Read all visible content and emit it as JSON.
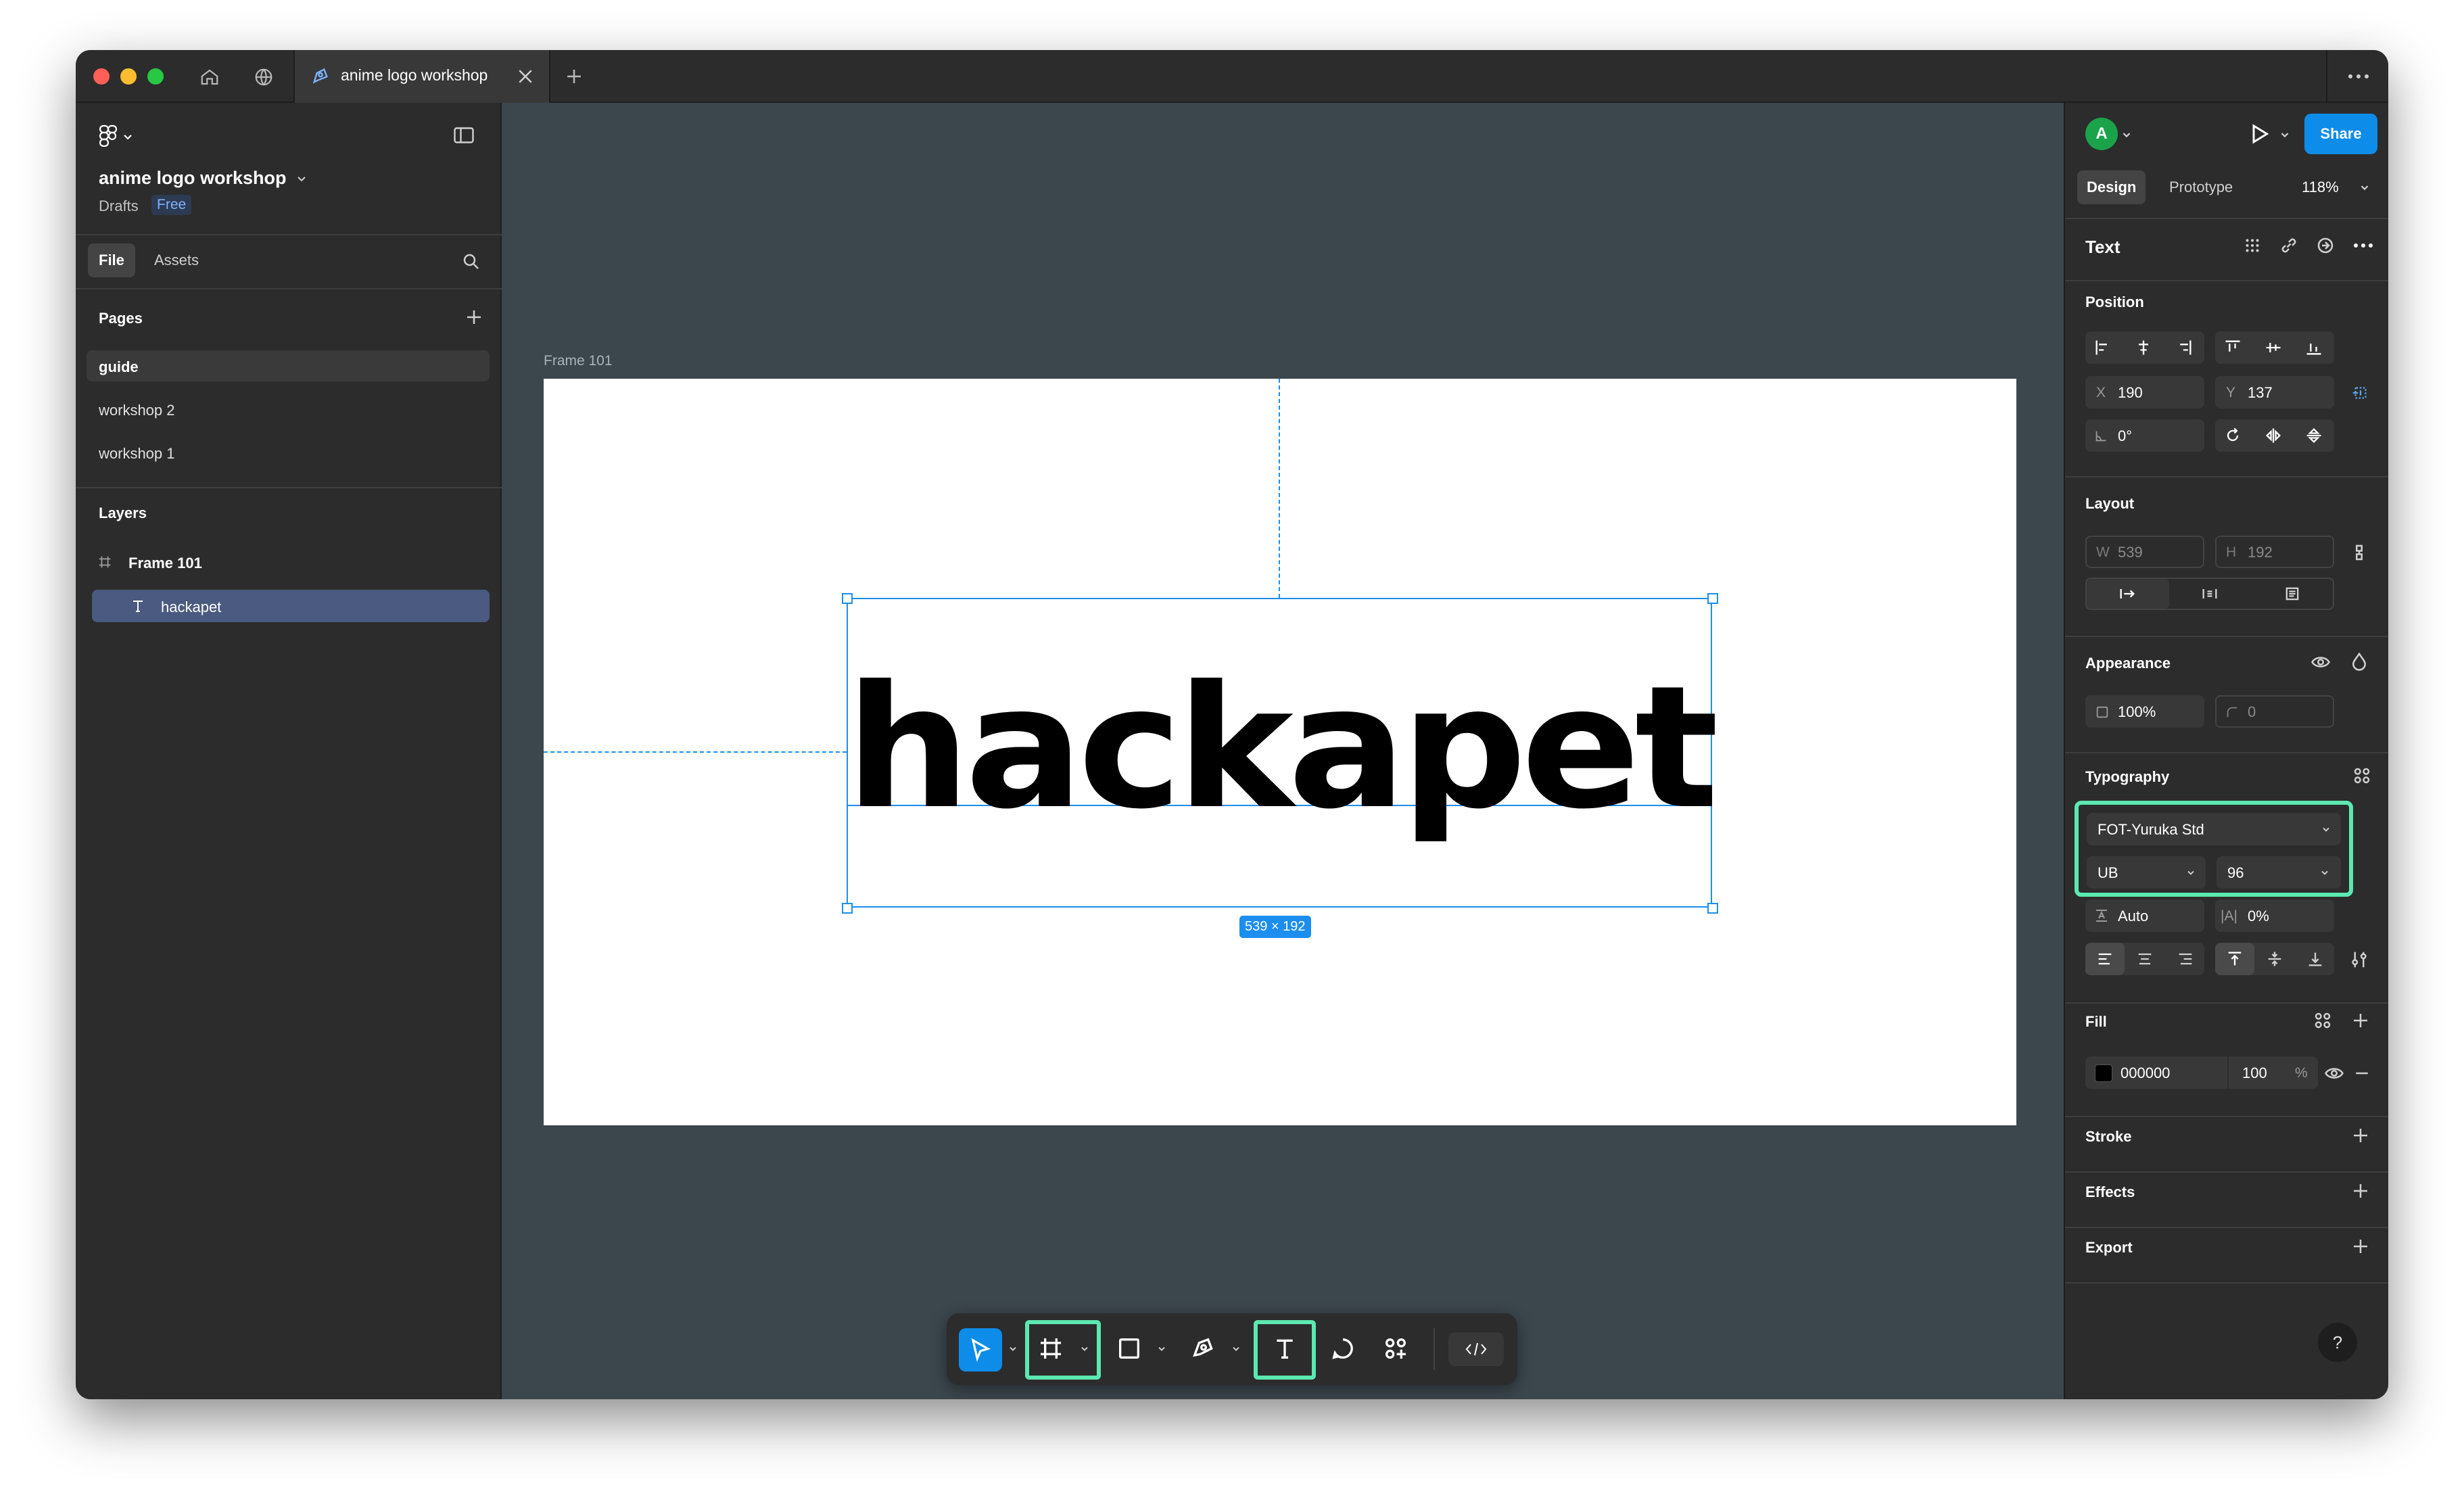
{
  "window": {
    "tab_title": "anime logo workshop"
  },
  "left_panel": {
    "file_name": "anime logo workshop",
    "location": "Drafts",
    "plan_badge": "Free",
    "tabs": [
      "File",
      "Assets"
    ],
    "pages_title": "Pages",
    "pages": [
      {
        "label": "guide",
        "selected": true
      },
      {
        "label": "workshop 2",
        "selected": false
      },
      {
        "label": "workshop 1",
        "selected": false
      }
    ],
    "layers_title": "Layers",
    "layers": [
      {
        "label": "Frame 101",
        "icon": "frame-icon",
        "selected": false
      },
      {
        "label": "hackapet",
        "icon": "text-icon",
        "selected": true
      }
    ]
  },
  "canvas": {
    "frame_label": "Frame 101",
    "text_content": "hackapet",
    "size_badge": "539 × 192",
    "selection_color": "#1b8ef0",
    "background": "#3c464d"
  },
  "right_panel": {
    "avatar_initial": "A",
    "avatar_color": "#1aa34a",
    "share_label": "Share",
    "share_color": "#0d8ce9",
    "tabs": [
      "Design",
      "Prototype"
    ],
    "zoom": "118%",
    "selection_type": "Text",
    "position": {
      "title": "Position",
      "x_label": "X",
      "x_value": "190",
      "y_label": "Y",
      "y_value": "137",
      "rotation": "0°"
    },
    "layout": {
      "title": "Layout",
      "w_label": "W",
      "w_value": "539",
      "h_label": "H",
      "h_value": "192"
    },
    "appearance": {
      "title": "Appearance",
      "opacity": "100%",
      "radius": "0"
    },
    "typography": {
      "title": "Typography",
      "font_family": "FOT-Yuruka Std",
      "font_style": "UB",
      "font_size": "96",
      "line_height": "Auto",
      "letter_spacing_label": "|A|",
      "letter_spacing": "0%"
    },
    "fill": {
      "title": "Fill",
      "color_hex": "000000",
      "swatch": "#000000",
      "opacity": "100",
      "percent": "%"
    },
    "stroke_title": "Stroke",
    "effects_title": "Effects",
    "export_title": "Export",
    "help": "?"
  },
  "toolbar": {
    "tools": [
      "move-tool",
      "frame-tool",
      "shape-tool",
      "pen-tool",
      "text-tool",
      "comment-tool",
      "actions-tool",
      "dev-mode-toggle"
    ],
    "highlight_color": "#5ce8b1"
  }
}
